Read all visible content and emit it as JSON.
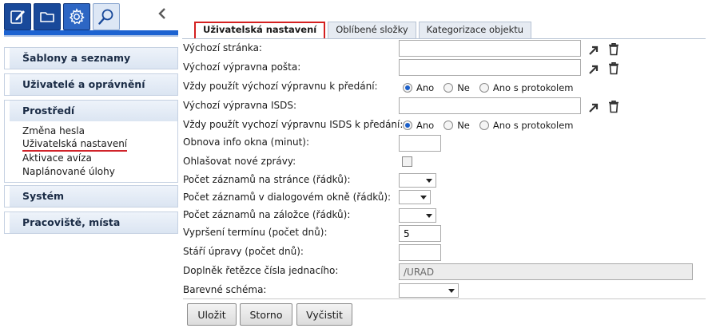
{
  "sidebar": {
    "sections": [
      {
        "label": "Šablony a seznamy"
      },
      {
        "label": "Uživatelé a oprávnění"
      },
      {
        "label": "Prostředí",
        "items": [
          "Změna hesla",
          "Uživatelská nastavení",
          "Aktivace avíza",
          "Naplánované úlohy"
        ],
        "current_item": "Uživatelská nastavení"
      },
      {
        "label": "Systém"
      },
      {
        "label": "Pracoviště, místa"
      }
    ]
  },
  "tabs": [
    {
      "label": "Uživatelská nastavení",
      "active": true
    },
    {
      "label": "Oblíbené složky",
      "active": false
    },
    {
      "label": "Kategorizace objektu",
      "active": false
    }
  ],
  "form": {
    "start_page": {
      "label": "Výchozí stránka:",
      "value": ""
    },
    "default_post": {
      "label": "Výchozí výpravna pošta:",
      "value": ""
    },
    "always_default_handover": {
      "label": "Vždy použít výchozí výpravnu k předání:",
      "options": [
        "Ano",
        "Ne",
        "Ano s protokolem"
      ],
      "selected": "Ano"
    },
    "default_isds": {
      "label": "Výchozí výpravna ISDS:",
      "value": ""
    },
    "always_isds_handover": {
      "label": "Vždy použít vychozí výpravnu ISDS k předání:",
      "options": [
        "Ano",
        "Ne",
        "Ano s protokolem"
      ],
      "selected": "Ano"
    },
    "refresh_info": {
      "label": "Obnova info okna (minut):",
      "value": ""
    },
    "announce_messages": {
      "label": "Ohlašovat nové zprávy:",
      "checked": false
    },
    "rows_per_page": {
      "label": "Počet záznamů na stránce (řádků):",
      "value": ""
    },
    "rows_in_dialog": {
      "label": "Počet záznamů v dialogovém okně (řádků):",
      "value": ""
    },
    "rows_in_tab": {
      "label": "Počet záznamů na záložce (řádků):",
      "value": ""
    },
    "deadline_expiry": {
      "label": "Vypršení termínu (počet dnů):",
      "value": "5"
    },
    "edit_age": {
      "label": "Stáří úpravy (počet dnů):",
      "value": ""
    },
    "ref_number_suffix": {
      "label": "Doplněk řetězce čísla jednacího:",
      "value": "/URAD"
    },
    "color_scheme": {
      "label": "Barevné schéma:",
      "value": ""
    }
  },
  "buttons": {
    "save": "Uložit",
    "cancel": "Storno",
    "clear": "Vyčistit"
  },
  "colors": {
    "accent": "#1d63d1",
    "active_tab_border": "#d42020",
    "toolbar_dark": "#19499a"
  },
  "icons": {
    "toolbar": [
      "edit-document-icon",
      "folder-icon",
      "settings-gear-icon",
      "search-magnifier-icon"
    ],
    "collapse": "chevron-left-icon",
    "row_actions": [
      "pick-arrow-icon",
      "trash-icon"
    ]
  }
}
